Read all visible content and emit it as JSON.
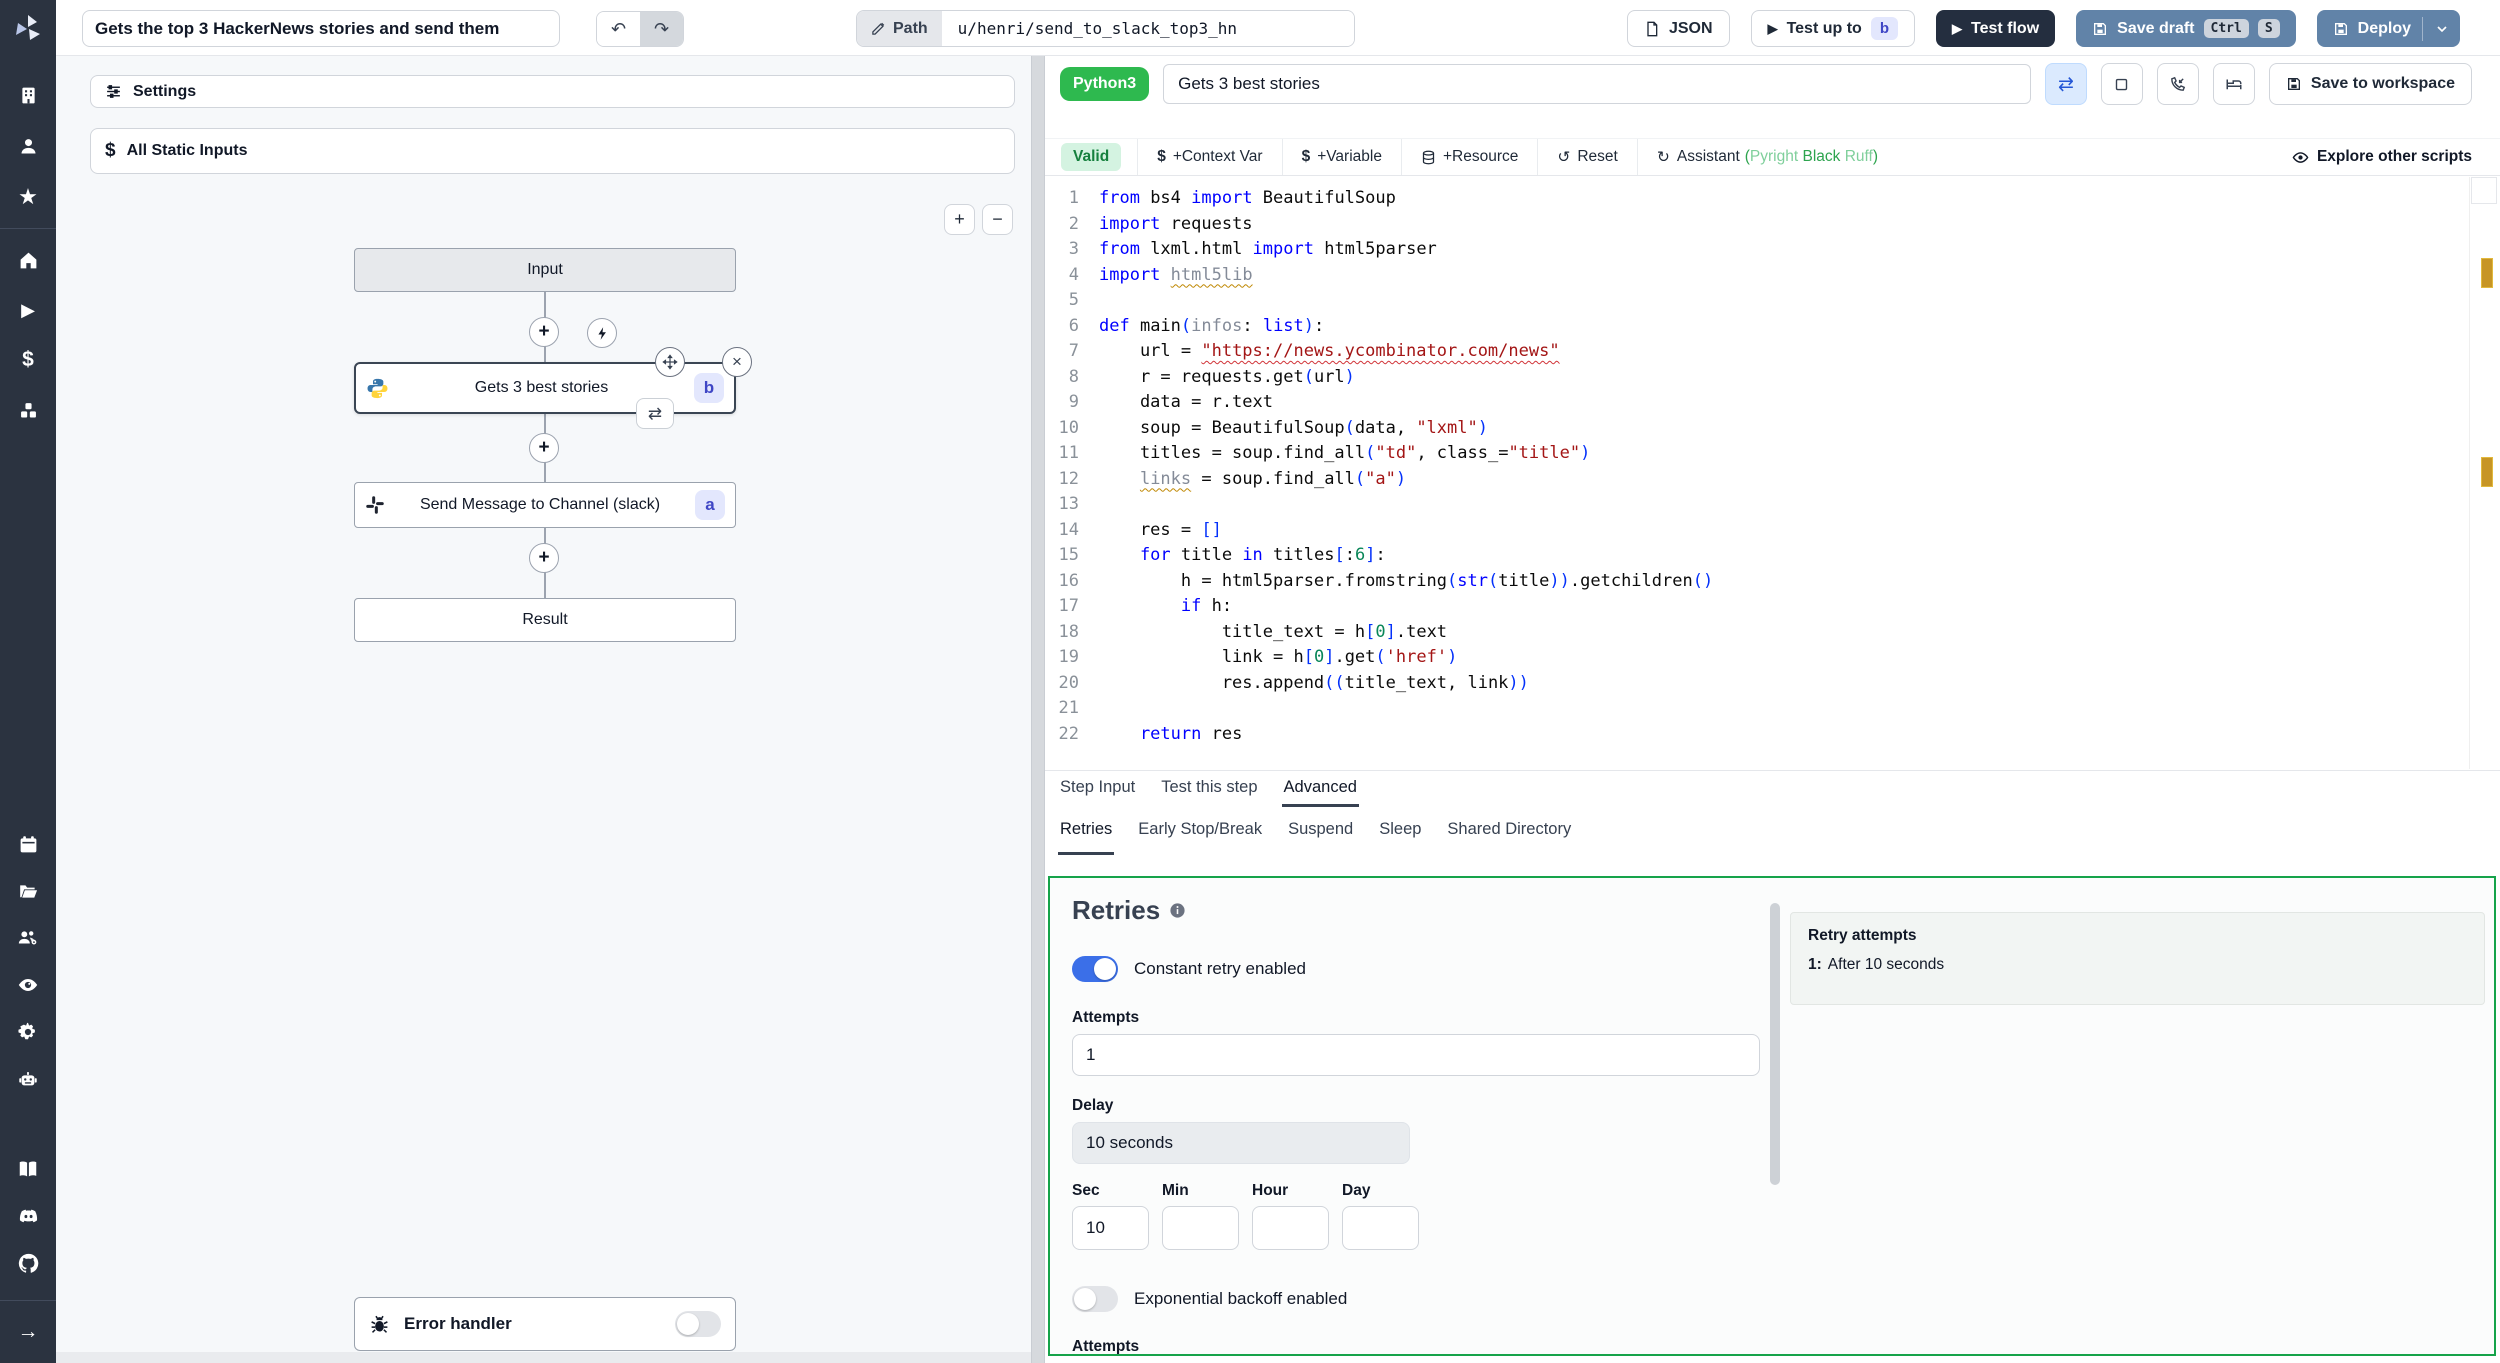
{
  "sidebar": {
    "icons": [
      "windmill-logo",
      "building",
      "user",
      "star",
      "home",
      "play",
      "dollar",
      "resources",
      "calendar",
      "folder",
      "groups",
      "audit-eye",
      "settings-gear",
      "worker-robot",
      "docs-book",
      "discord",
      "github",
      "expand-arrow"
    ]
  },
  "topbar": {
    "flow_title": "Gets the top 3 HackerNews stories and send them",
    "path_label": "Path",
    "path_value": "u/henri/send_to_slack_top3_hn",
    "json_label": "JSON",
    "test_up_to_label": "Test up to",
    "test_up_to_step": "b",
    "test_flow_label": "Test flow",
    "save_draft_label": "Save draft",
    "save_draft_shortcut": [
      "Ctrl",
      "S"
    ],
    "deploy_label": "Deploy"
  },
  "flow": {
    "settings_label": "Settings",
    "static_inputs_label": "All Static Inputs",
    "zoom_in": "+",
    "zoom_out": "−",
    "input_label": "Input",
    "steps": [
      {
        "badge": "b",
        "label": "Gets 3 best stories",
        "lang": "python"
      },
      {
        "badge": "a",
        "label": "Send Message to Channel (slack)",
        "lang": "slack"
      }
    ],
    "result_label": "Result",
    "error_handler_label": "Error handler"
  },
  "editor": {
    "language_badge": "Python3",
    "step_name": "Gets 3 best stories",
    "valid_badge": "Valid",
    "context_var_label": "+Context Var",
    "variable_label": "+Variable",
    "resource_label": "+Resource",
    "reset_label": "Reset",
    "assistant_label": "Assistant",
    "assistant_paren_open": "(",
    "assistant_paren_close": ")",
    "assistant_tools": [
      "Pyright",
      "Black ",
      "Ruff"
    ],
    "save_to_workspace_label": "Save to workspace",
    "explore_label": "Explore other scripts",
    "code_lines": [
      {
        "n": "1",
        "t": [
          [
            "kw",
            "from"
          ],
          [
            "pl",
            " bs4 "
          ],
          [
            "kw",
            "import"
          ],
          [
            "pl",
            " BeautifulSoup"
          ]
        ]
      },
      {
        "n": "2",
        "t": [
          [
            "kw",
            "import"
          ],
          [
            "pl",
            " requests"
          ]
        ]
      },
      {
        "n": "3",
        "t": [
          [
            "kw",
            "from"
          ],
          [
            "pl",
            " lxml.html "
          ],
          [
            "kw",
            "import"
          ],
          [
            "pl",
            " html5parser"
          ]
        ]
      },
      {
        "n": "4",
        "t": [
          [
            "kw",
            "import"
          ],
          [
            "pl",
            " "
          ],
          [
            "unw",
            "html5lib"
          ]
        ]
      },
      {
        "n": "5",
        "t": []
      },
      {
        "n": "6",
        "t": [
          [
            "kw",
            "def"
          ],
          [
            "pl",
            " main"
          ],
          [
            "br",
            "("
          ],
          [
            "un",
            "infos"
          ],
          [
            "pl",
            ": "
          ],
          [
            "kw",
            "list"
          ],
          [
            "br",
            ")"
          ],
          [
            "pl",
            ":"
          ]
        ]
      },
      {
        "n": "7",
        "t": [
          [
            "pl",
            "    url = "
          ],
          [
            "stu",
            "\"https://news.ycombinator.com/news\""
          ]
        ]
      },
      {
        "n": "8",
        "t": [
          [
            "pl",
            "    r = requests.get"
          ],
          [
            "br",
            "("
          ],
          [
            "pl",
            "url"
          ],
          [
            "br",
            ")"
          ]
        ]
      },
      {
        "n": "9",
        "t": [
          [
            "pl",
            "    data = r.text"
          ]
        ]
      },
      {
        "n": "10",
        "t": [
          [
            "pl",
            "    soup = BeautifulSoup"
          ],
          [
            "br",
            "("
          ],
          [
            "pl",
            "data, "
          ],
          [
            "st",
            "\"lxml\""
          ],
          [
            "br",
            ")"
          ]
        ]
      },
      {
        "n": "11",
        "t": [
          [
            "pl",
            "    titles = soup.find_all"
          ],
          [
            "br",
            "("
          ],
          [
            "st",
            "\"td\""
          ],
          [
            "pl",
            ", class_="
          ],
          [
            "st",
            "\"title\""
          ],
          [
            "br",
            ")"
          ]
        ]
      },
      {
        "n": "12",
        "t": [
          [
            "pl",
            "    "
          ],
          [
            "unw",
            "links"
          ],
          [
            "pl",
            " = soup.find_all"
          ],
          [
            "br",
            "("
          ],
          [
            "st",
            "\"a\""
          ],
          [
            "br",
            ")"
          ]
        ]
      },
      {
        "n": "13",
        "t": []
      },
      {
        "n": "14",
        "t": [
          [
            "pl",
            "    res = "
          ],
          [
            "br",
            "[]"
          ]
        ]
      },
      {
        "n": "15",
        "t": [
          [
            "kw",
            "    for"
          ],
          [
            "pl",
            " title "
          ],
          [
            "kw",
            "in"
          ],
          [
            "pl",
            " titles"
          ],
          [
            "br",
            "["
          ],
          [
            "pl",
            ":"
          ],
          [
            "nu",
            "6"
          ],
          [
            "br",
            "]"
          ],
          [
            "pl",
            ":"
          ]
        ]
      },
      {
        "n": "16",
        "t": [
          [
            "pl",
            "        h = html5parser.fromstring"
          ],
          [
            "br",
            "("
          ],
          [
            "kw",
            "str"
          ],
          [
            "br",
            "("
          ],
          [
            "pl",
            "title"
          ],
          [
            "br",
            "))"
          ],
          [
            "pl",
            ".getchildren"
          ],
          [
            "br",
            "()"
          ]
        ]
      },
      {
        "n": "17",
        "t": [
          [
            "kw",
            "        if"
          ],
          [
            "pl",
            " h:"
          ]
        ]
      },
      {
        "n": "18",
        "t": [
          [
            "pl",
            "            title_text = h"
          ],
          [
            "br",
            "["
          ],
          [
            "nu",
            "0"
          ],
          [
            "br",
            "]"
          ],
          [
            "pl",
            ".text"
          ]
        ]
      },
      {
        "n": "19",
        "t": [
          [
            "pl",
            "            link = h"
          ],
          [
            "br",
            "["
          ],
          [
            "nu",
            "0"
          ],
          [
            "br",
            "]"
          ],
          [
            "pl",
            ".get"
          ],
          [
            "br",
            "("
          ],
          [
            "st",
            "'href'"
          ],
          [
            "br",
            ")"
          ]
        ]
      },
      {
        "n": "20",
        "t": [
          [
            "pl",
            "            res.append"
          ],
          [
            "br",
            "(("
          ],
          [
            "pl",
            "title_text, link"
          ],
          [
            "br",
            "))"
          ]
        ]
      },
      {
        "n": "21",
        "t": []
      },
      {
        "n": "22",
        "t": [
          [
            "kw",
            "    return"
          ],
          [
            "pl",
            " res"
          ]
        ]
      }
    ]
  },
  "tabs": {
    "step_tabs": [
      "Step Input",
      "Test this step",
      "Advanced"
    ],
    "active_step_tab": "Advanced",
    "advanced_tabs": [
      "Retries",
      "Early Stop/Break",
      "Suspend",
      "Sleep",
      "Shared Directory"
    ],
    "active_advanced_tab": "Retries"
  },
  "retries": {
    "title": "Retries",
    "constant_toggle_label": "Constant retry enabled",
    "constant_enabled": true,
    "attempts_label": "Attempts",
    "attempts_value": "1",
    "delay_label": "Delay",
    "delay_value": "10 seconds",
    "sec_label": "Sec",
    "sec_value": "10",
    "min_label": "Min",
    "min_value": "",
    "hour_label": "Hour",
    "hour_value": "",
    "day_label": "Day",
    "day_value": "",
    "exponential_toggle_label": "Exponential backoff enabled",
    "exponential_enabled": false,
    "bottom_cut_label": "Attempts",
    "summary": {
      "title": "Retry attempts",
      "line_prefix": "1:",
      "line_text": "After 10 seconds"
    }
  }
}
